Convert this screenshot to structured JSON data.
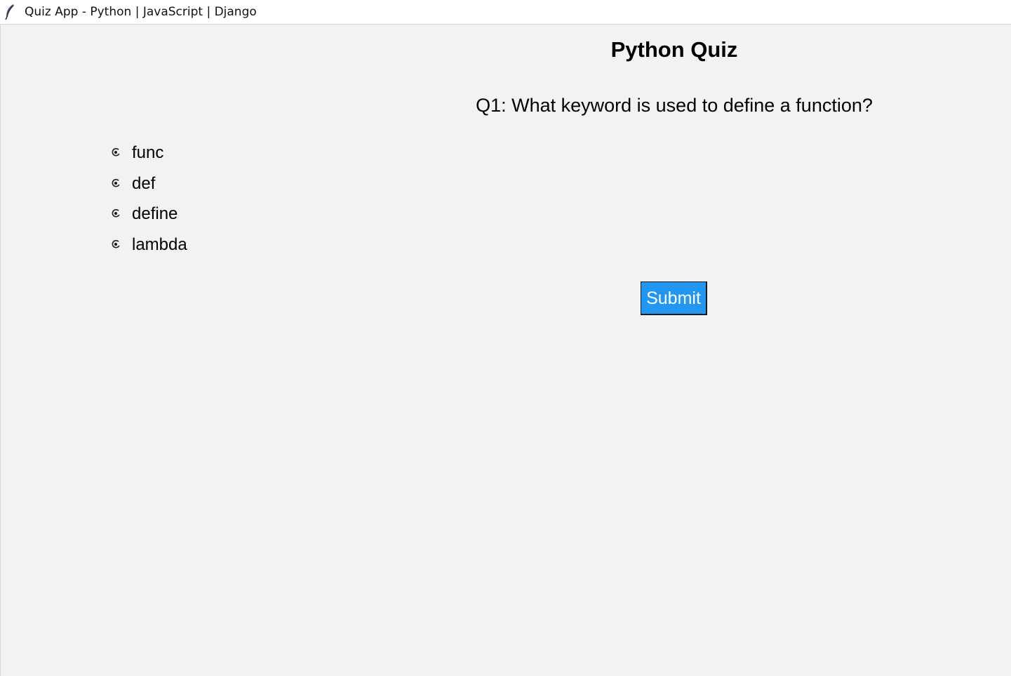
{
  "window": {
    "title": "Quiz App - Python | JavaScript | Django",
    "icon": "feather-icon"
  },
  "quiz": {
    "title": "Python Quiz",
    "question": "Q1: What keyword is used to define a function?",
    "options": [
      {
        "label": "func",
        "selected": false
      },
      {
        "label": "def",
        "selected": false
      },
      {
        "label": "define",
        "selected": false
      },
      {
        "label": "lambda",
        "selected": false
      }
    ],
    "submit_label": "Submit"
  },
  "colors": {
    "background": "#f2f2f2",
    "titlebar": "#ffffff",
    "submit_button": "#2196f3",
    "submit_text": "#ffffff"
  }
}
